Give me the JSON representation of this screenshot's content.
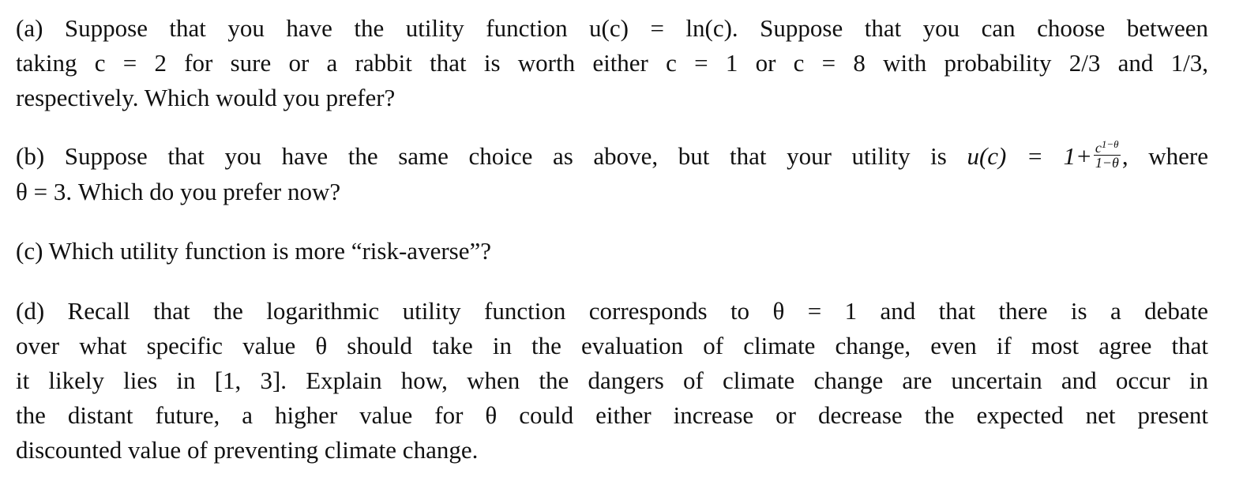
{
  "document": {
    "part_a": {
      "lines": [
        "(a) Suppose that you have the utility function u(c) = ln(c). Suppose that you can choose between",
        "taking c = 2 for sure or a rabbit that is worth either c = 1 or c = 8 with probability 2/3 and 1/3,",
        "respectively. Which would you prefer?"
      ]
    },
    "part_b": {
      "line1_before": "(b) Suppose that you have the same choice as above, but that your utility is ",
      "formula_lhs": "u(c) = 1+",
      "frac_num_base": "c",
      "frac_num_exp": "1−θ",
      "frac_den": "1−θ",
      "line1_after": ", where",
      "line2": "θ = 3. Which do you prefer now?"
    },
    "part_c": {
      "text": "(c) Which utility function is more “risk-averse”?"
    },
    "part_d": {
      "lines": [
        "(d) Recall that the logarithmic utility function corresponds to θ = 1 and that there is a debate",
        "over what specific value θ should take in the evaluation of climate change, even if most agree that",
        "it likely lies in [1, 3]. Explain how, when the dangers of climate change are uncertain and occur in",
        "the distant future, a higher value for θ could either increase or decrease the expected net present",
        "discounted value of preventing climate change."
      ]
    }
  }
}
